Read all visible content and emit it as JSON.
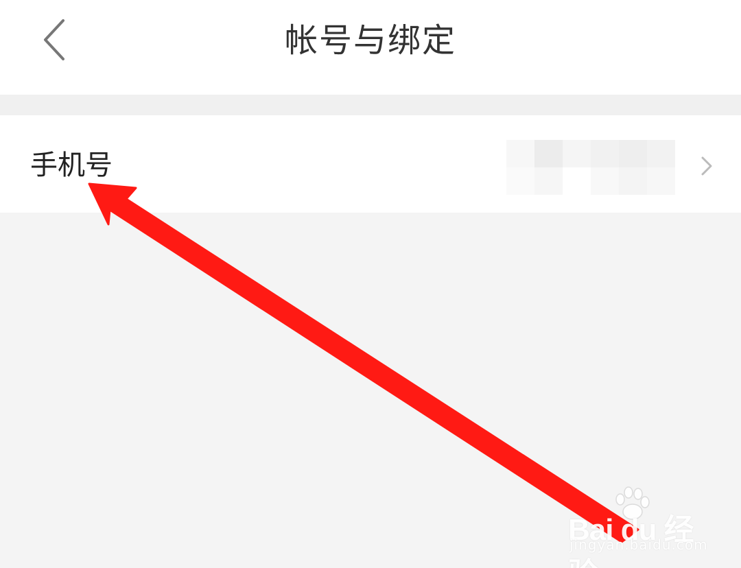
{
  "header": {
    "title": "帐号与绑定",
    "back_icon": "chevron-left-icon"
  },
  "rows": [
    {
      "label": "手机号",
      "value_state": "blurred",
      "chevron_icon": "chevron-right-icon"
    }
  ],
  "annotation": {
    "type": "arrow",
    "color": "#ff1a14",
    "points_to": "手机号"
  },
  "watermark": {
    "brand": "Bai du 经验",
    "url": "jingyan.baidu.com"
  },
  "colors": {
    "background": "#f4f4f4",
    "surface": "#ffffff",
    "title_text": "#333333",
    "label_text": "#222222",
    "icon_gray": "#777777",
    "chevron_gray": "#bbbbbb"
  }
}
